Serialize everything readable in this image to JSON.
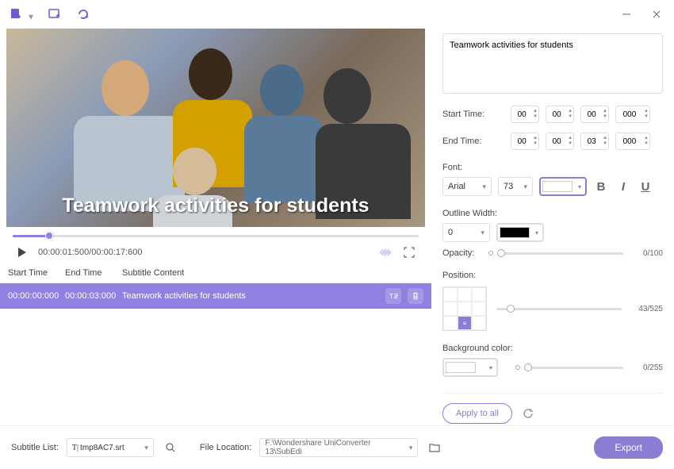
{
  "toolbar": {
    "btn1": "add-doc",
    "btn2": "add-window",
    "btn3": "refresh-arc"
  },
  "video": {
    "subtitle_overlay": "Teamwork activities for students",
    "timecode": "00:00:01:500/00:00:17:600"
  },
  "table": {
    "headers": {
      "start": "Start Time",
      "end": "End Time",
      "content": "Subtitle Content"
    },
    "row": {
      "start": "00:00:00:000",
      "end": "00:00:03:000",
      "content": "Teamwork activities for students"
    }
  },
  "editor": {
    "text": "Teamwork activities for students",
    "start_label": "Start Time:",
    "end_label": "End Time:",
    "start": {
      "h": "00",
      "m": "00",
      "s": "00",
      "ms": "000"
    },
    "end": {
      "h": "00",
      "m": "00",
      "s": "03",
      "ms": "000"
    },
    "font_label": "Font:",
    "font_family": "Arial",
    "font_size": "73",
    "outline_label": "Outline Width:",
    "outline_width": "0",
    "opacity_label": "Opacity:",
    "opacity_value": "0/100",
    "position_label": "Position:",
    "position_value": "43/525",
    "bg_label": "Background color:",
    "bg_value": "0/255",
    "apply_label": "Apply to all"
  },
  "footer": {
    "list_label": "Subtitle List:",
    "file_name": "tmp8AC7.srt",
    "loc_label": "File Location:",
    "loc_path": "F:\\Wondershare UniConverter 13\\SubEdi",
    "export_label": "Export"
  }
}
